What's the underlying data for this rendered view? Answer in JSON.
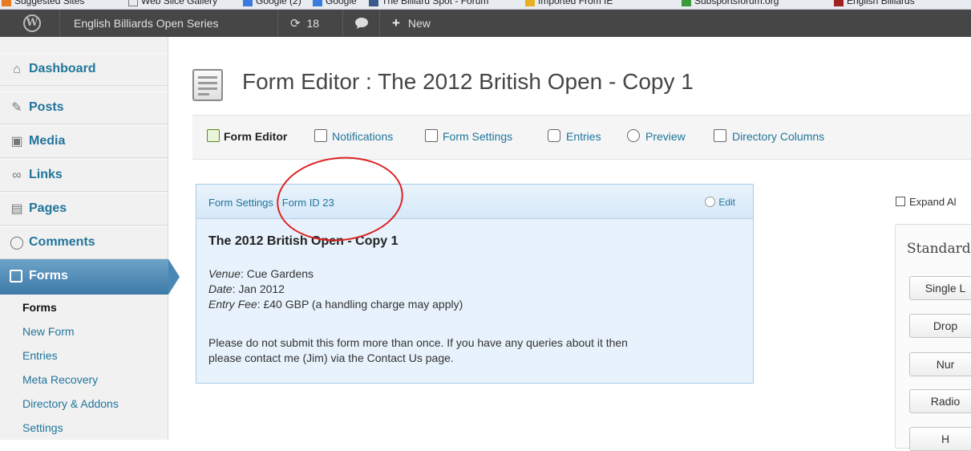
{
  "bookmarks": {
    "items": [
      "Suggested Sites",
      "Web Slice Gallery",
      "Google (2)",
      "Google",
      "The Billiard Spot - Forum",
      "Imported From IE",
      "Subsportsforum.org",
      "English Billiards"
    ]
  },
  "adminbar": {
    "site_name": "English Billiards Open Series",
    "updates_count": "18",
    "new_label": "New"
  },
  "sidebar": {
    "menu": [
      {
        "label": "Dashboard",
        "icon": "house-icon"
      },
      {
        "label": "Posts",
        "icon": "pin-icon"
      },
      {
        "label": "Media",
        "icon": "media-icon"
      },
      {
        "label": "Links",
        "icon": "link-icon"
      },
      {
        "label": "Pages",
        "icon": "pages-icon"
      },
      {
        "label": "Comments",
        "icon": "comment-icon"
      }
    ],
    "active_menu": "Forms",
    "submenu": [
      "Forms",
      "New Form",
      "Entries",
      "Meta Recovery",
      "Directory & Addons",
      "Settings"
    ]
  },
  "page": {
    "title": "Form Editor : The 2012 British Open - Copy 1"
  },
  "toolbar": {
    "items": [
      "Form Editor",
      "Notifications",
      "Form Settings",
      "Entries",
      "Preview",
      "Directory Columns"
    ]
  },
  "panel": {
    "head_prefix": "Form Settings : ",
    "head_id": "Form ID 23",
    "edit_label": "Edit",
    "form_title": "The 2012 British Open - Copy 1",
    "venue_label": "Venue",
    "venue_value": ": Cue Gardens",
    "date_label": "Date",
    "date_value": ": Jan 2012",
    "fee_label": "Entry Fee",
    "fee_value": ": £40 GBP (a handling charge may apply)",
    "note_line1": "Please do not submit this form more than once. If you have any queries about it then",
    "note_line2": "please contact me (Jim) via the Contact Us page."
  },
  "right": {
    "expand_label": "Expand Al",
    "standard_heading": "Standard",
    "buttons": [
      "Single L",
      "Drop",
      "Nur",
      "Radio",
      "H"
    ]
  },
  "colors": {
    "link": "#21759b",
    "active_menu": "#3d7aa8",
    "panel_bg": "#e7f2fc",
    "annotation": "#dd2222"
  }
}
